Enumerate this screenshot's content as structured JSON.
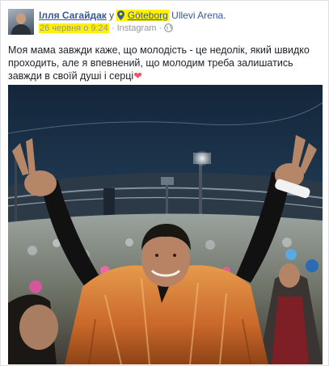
{
  "post": {
    "author": "Ілля Сагайдак",
    "preposition": "у",
    "location_highlight": "Göteborg",
    "location_rest": "Ullevi Arena.",
    "date": "26 червня о 9:24",
    "source": "· Instagram ·",
    "message": "Моя мама завжди каже, що молодість - це недолік, який швидко проходить, але я впевнений, що молодим треба залишатись завжди в своїй душі і серці",
    "emoji": "❤",
    "highlight_color": "#fff200",
    "link_color": "#365899",
    "icons": {
      "location": "map-pin-icon",
      "privacy": "globe-icon",
      "emoji": "heart-emoji"
    }
  }
}
